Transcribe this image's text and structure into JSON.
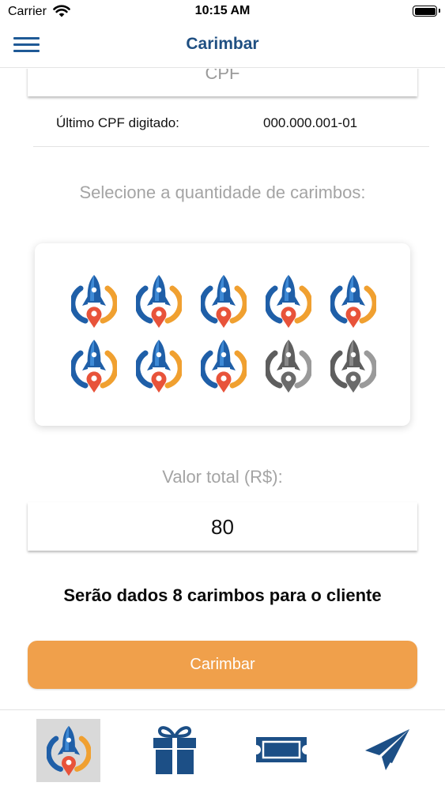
{
  "status_bar": {
    "carrier": "Carrier",
    "time": "10:15 AM"
  },
  "nav": {
    "title": "Carimbar",
    "menu_icon": "hamburger-menu-icon"
  },
  "cpf": {
    "placeholder": "CPF",
    "last_label": "Último CPF digitado:",
    "last_value": "000.000.001-01"
  },
  "stamps": {
    "label": "Selecione a quantidade de carimbos:",
    "total": 10,
    "selected": 8,
    "icon": "rocket-location-stamp-icon",
    "colors": {
      "active_blue": "#1f5fa8",
      "active_orange": "#f0a030",
      "pin_red": "#e8533a",
      "inactive_gray": "#7a7a7a"
    }
  },
  "total_value": {
    "label": "Valor total (R$):",
    "value": "80"
  },
  "summary": "Serão dados 8 carimbos para o cliente",
  "action": {
    "label": "Carimbar",
    "color": "#f0a04b"
  },
  "tab_bar": {
    "items": [
      {
        "icon": "rocket-stamp-icon",
        "selected": true
      },
      {
        "icon": "gift-icon",
        "selected": false
      },
      {
        "icon": "ticket-icon",
        "selected": false
      },
      {
        "icon": "paper-plane-icon",
        "selected": false
      }
    ],
    "color": "#1c4f86"
  }
}
